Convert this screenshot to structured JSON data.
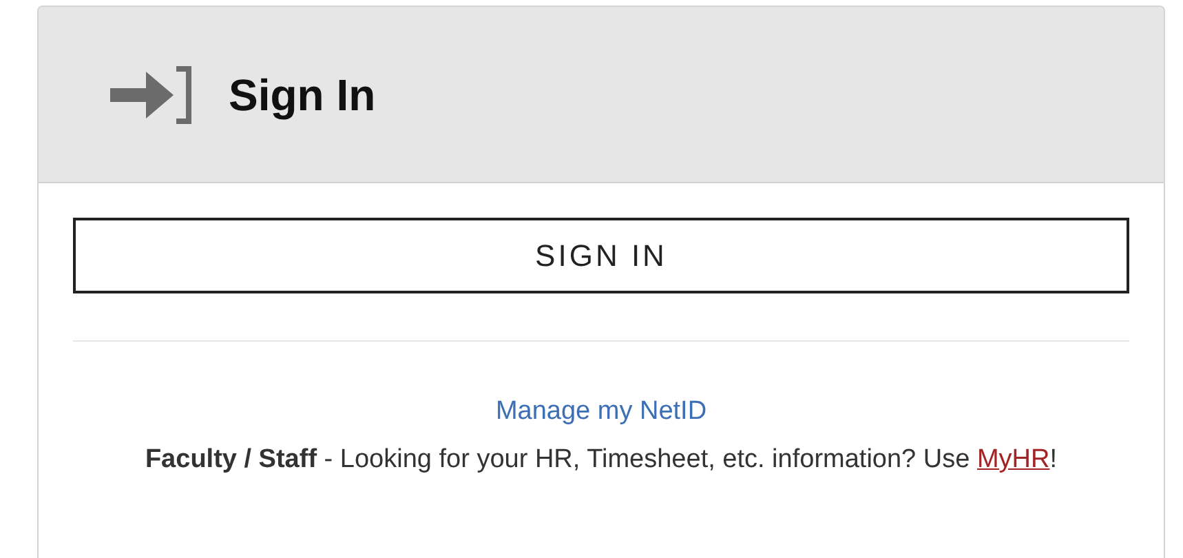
{
  "header": {
    "title": "Sign In"
  },
  "sign_in_button": {
    "label": "SIGN IN"
  },
  "manage_link": {
    "label": "Manage my NetID"
  },
  "info": {
    "text": "**Faculty / Staff** - Looking for your HR, Timesheet, etc. information? Use",
    "link": "MyHR",
    "after": "!"
  }
}
